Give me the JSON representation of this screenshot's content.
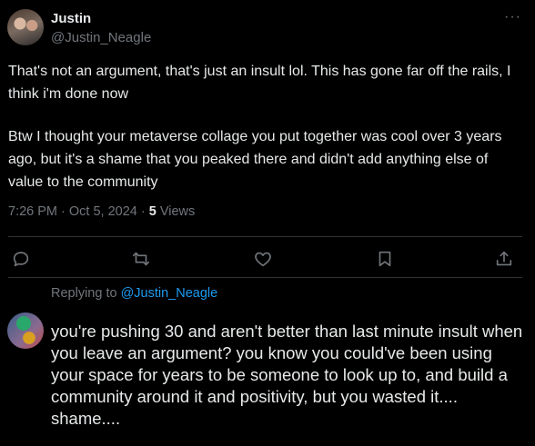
{
  "tweet": {
    "author_name": "Justin",
    "author_handle": "@Justin_Neagle",
    "more_label": "···",
    "paragraph1": "That's not an argument, that's just an insult lol. This has gone far off the rails, I think i'm done now",
    "paragraph2": "Btw I thought your metaverse collage you put together was cool over 3 years ago, but it's a shame that you peaked there and didn't add anything else of value to the community",
    "timestamp": "7:26 PM · Oct 5, 2024 · ",
    "views_count": "5",
    "views_label": " Views"
  },
  "actions": [
    "reply-icon",
    "retweet-icon",
    "like-icon",
    "bookmark-icon",
    "share-icon"
  ],
  "reply": {
    "replying_prefix": "Replying to ",
    "replying_handle": "@Justin_Neagle",
    "text": "you're pushing 30 and aren't better than last minute insult when you leave an argument? you know you could've been using your space for years to be someone to look up to, and build a community around it and positivity, but you wasted it.... shame...."
  },
  "colors": {
    "background": "#000000",
    "text": "#e7e9ea",
    "muted": "#71767b",
    "link": "#1d9bf0",
    "divider": "#2f3336"
  }
}
